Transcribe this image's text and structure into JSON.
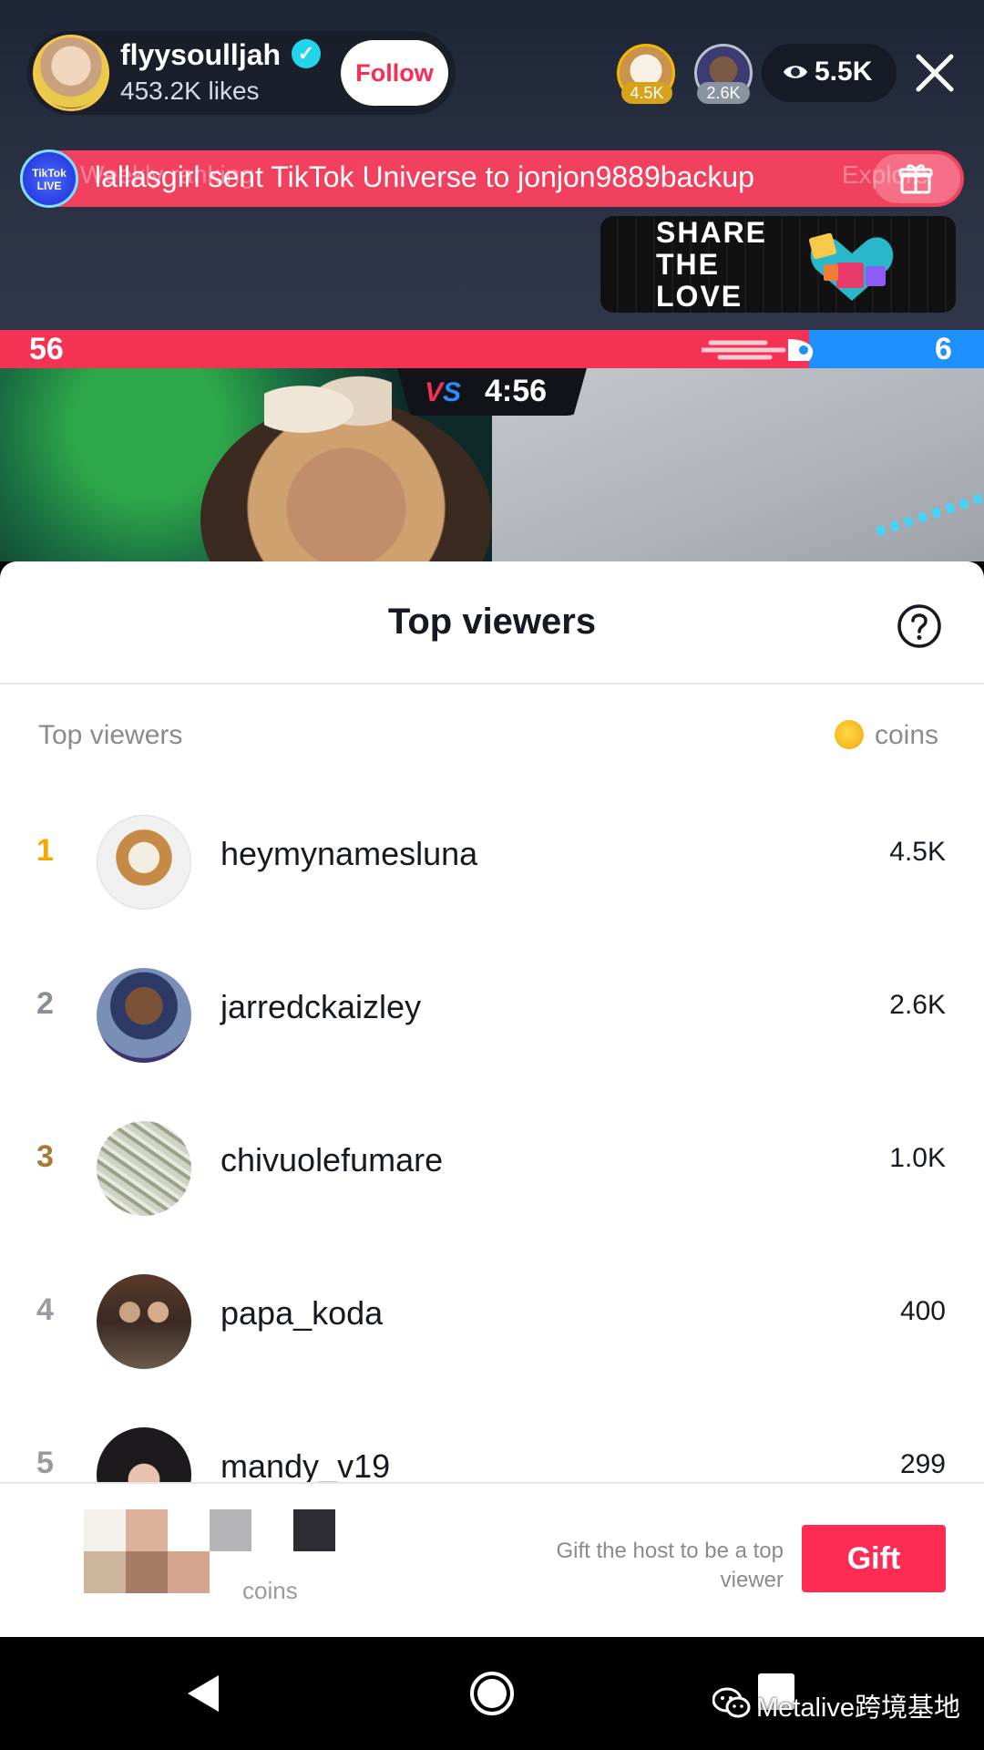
{
  "host": {
    "name": "flyysoulljah",
    "likes": "453.2K likes",
    "follow_label": "Follow"
  },
  "top_badges": [
    {
      "count": "4.5K"
    },
    {
      "count": "2.6K"
    }
  ],
  "viewer_count": "5.5K",
  "ticker": {
    "text": "lallasgirl sent TikTok Universe to jonjon9889backup",
    "ghost_left": "Weekly ranking",
    "ghost_right": "Explore",
    "live_badge": "TikTok LIVE"
  },
  "share_banner": "SHARE\nTHE\nLOVE",
  "battle": {
    "left_score": "56",
    "right_score": "6",
    "timer": "4:56",
    "left_share": 0.822
  },
  "sheet": {
    "title": "Top viewers",
    "section_label": "Top viewers",
    "coins_label": "coins"
  },
  "viewers": [
    {
      "rank": "1",
      "name": "heymynamesluna",
      "score": "4.5K"
    },
    {
      "rank": "2",
      "name": "jarredckaizley",
      "score": "2.6K"
    },
    {
      "rank": "3",
      "name": "chivuolefumare",
      "score": "1.0K"
    },
    {
      "rank": "4",
      "name": "papa_koda",
      "score": "400"
    },
    {
      "rank": "5",
      "name": "mandy_v19",
      "score": "299"
    }
  ],
  "bottom": {
    "my_coins_label": "coins",
    "gift_hint": "Gift the host to be a top viewer",
    "gift_label": "Gift"
  },
  "watermark": "Metalive跨境基地",
  "colors": {
    "accent": "#fe2c55",
    "battle_red": "#f43254",
    "battle_blue": "#1e90ff",
    "rank1": "#f5a800",
    "rank2": "#8a9099",
    "rank3": "#a87a3a"
  }
}
